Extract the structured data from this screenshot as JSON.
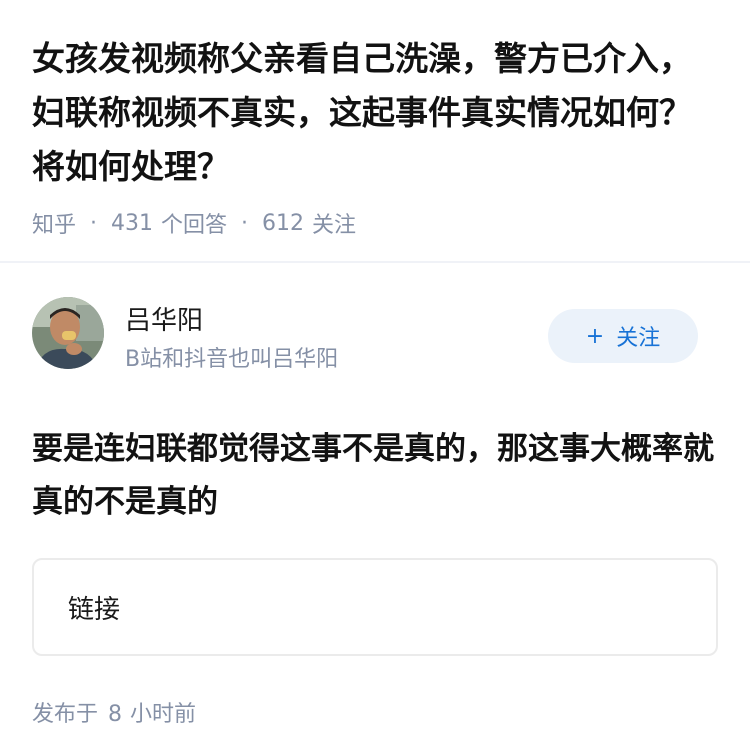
{
  "question": {
    "title": "女孩发视频称父亲看自己洗澡，警方已介入，妇联称视频不真实，这起事件真实情况如何？将如何处理？",
    "source": "知乎",
    "answer_count": "431",
    "answer_label": "个回答",
    "follow_count": "612",
    "follow_label": "关注"
  },
  "author": {
    "name": "吕华阳",
    "bio": "B站和抖音也叫吕华阳",
    "follow_plus": "+",
    "follow_label": "关注"
  },
  "answer": {
    "text": "要是连妇联都觉得这事不是真的，那这事大概率就真的不是真的"
  },
  "link_card": {
    "label": "链接"
  },
  "posted": {
    "prefix": "发布于",
    "amount": "8",
    "unit": "小时前"
  },
  "colors": {
    "meta_gray": "#8590a6",
    "accent_blue": "#1772d6",
    "follow_bg": "#ebf2fa"
  }
}
